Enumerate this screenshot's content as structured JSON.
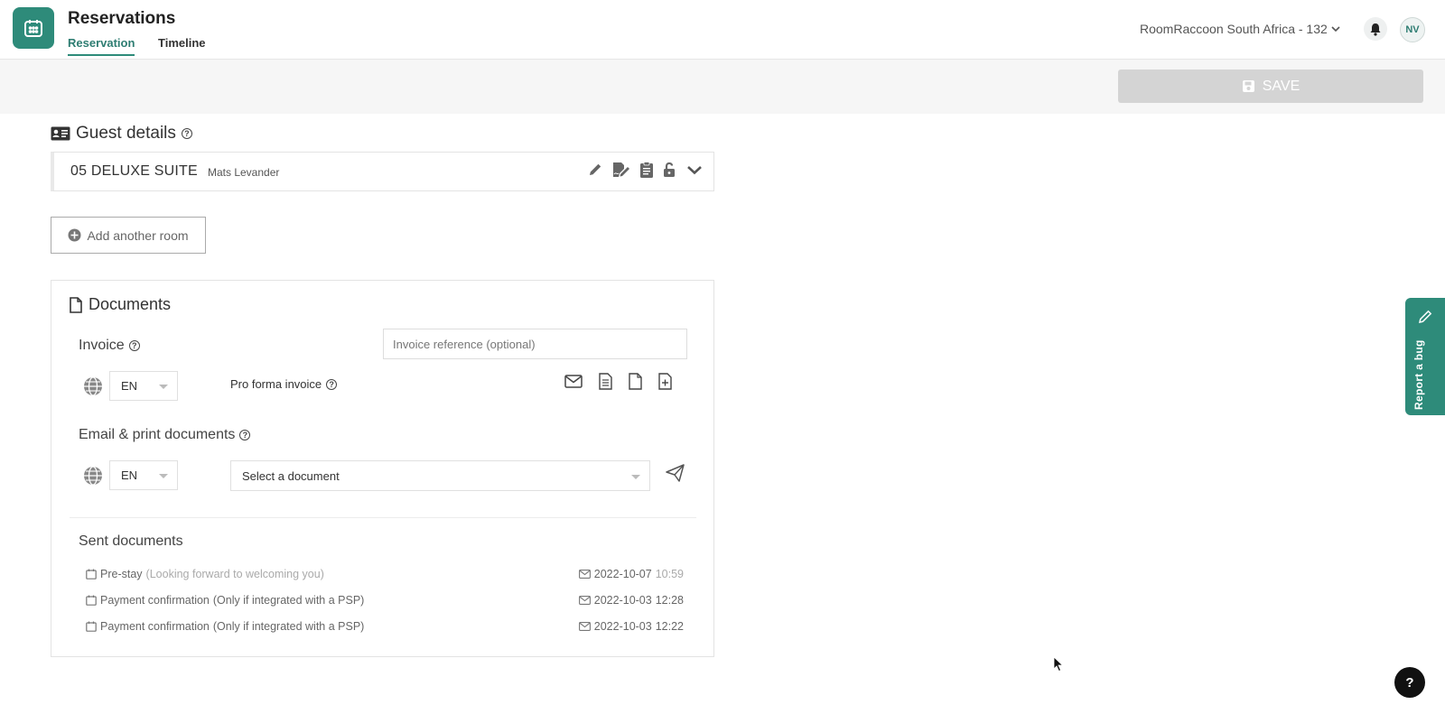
{
  "header": {
    "app_title": "Reservations",
    "tabs": [
      {
        "label": "Reservation",
        "active": true
      },
      {
        "label": "Timeline",
        "active": false
      }
    ],
    "property_name": "RoomRaccoon South Africa - 132",
    "avatar_initials": "NV"
  },
  "toolbar": {
    "save_label": "SAVE"
  },
  "guest_details": {
    "title": "Guest details",
    "room": {
      "name": "05 DELUXE SUITE",
      "guest": "Mats Levander"
    },
    "add_room_label": "Add another room"
  },
  "documents": {
    "title": "Documents",
    "invoice_label": "Invoice",
    "invoice_ref_placeholder": "Invoice reference (optional)",
    "invoice_lang": "EN",
    "pro_forma_label": "Pro forma invoice",
    "email_print_label": "Email & print documents",
    "email_lang": "EN",
    "select_document_placeholder": "Select a document",
    "sent_title": "Sent documents",
    "sent": [
      {
        "name": "Pre-stay",
        "note": "(Looking forward to welcoming you)",
        "date": "2022-10-07",
        "time": "10:59"
      },
      {
        "name": "Payment confirmation",
        "note": "(Only if integrated with a PSP)",
        "date": "2022-10-03",
        "time": "12:28"
      },
      {
        "name": "Payment confirmation",
        "note": "(Only if integrated with a PSP)",
        "date": "2022-10-03",
        "time": "12:22"
      }
    ]
  },
  "report_bug_label": "Report a bug",
  "help_fab_label": "?",
  "colors": {
    "brand": "#2e8b7a",
    "save_disabled": "#d4d4d4"
  }
}
